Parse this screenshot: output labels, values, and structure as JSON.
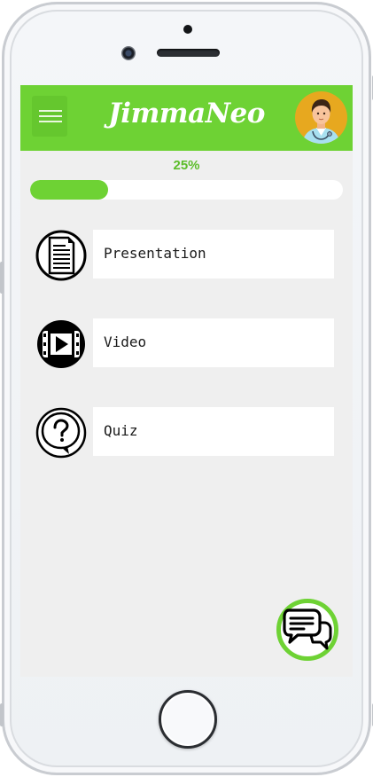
{
  "app": {
    "title": "JimmaNeo"
  },
  "header": {
    "menu_icon": "hamburger-menu-icon",
    "avatar_icon": "doctor-avatar-icon",
    "bg_color": "#6ed234"
  },
  "progress": {
    "label": "25%",
    "value": 0.25,
    "fill_color": "#6ed234"
  },
  "menu": {
    "items": [
      {
        "label": "Presentation",
        "icon": "document-icon"
      },
      {
        "label": "Video",
        "icon": "video-play-icon"
      },
      {
        "label": "Quiz",
        "icon": "question-icon"
      }
    ]
  },
  "chat": {
    "icon": "chat-bubbles-icon",
    "border_color": "#6ed234"
  }
}
